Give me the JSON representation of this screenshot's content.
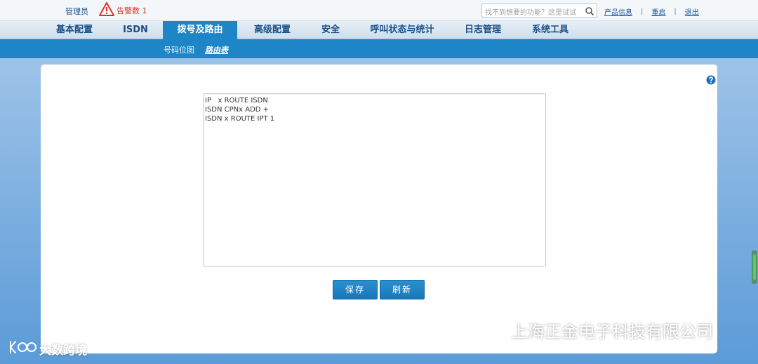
{
  "topbar": {
    "admin_label": "管理员",
    "alarm_label": "告警数 1",
    "search_placeholder": "找不到想要的功能？这里试试",
    "links": [
      "产品信息",
      "重启",
      "退出"
    ],
    "link_separator": "|"
  },
  "main_nav": {
    "tabs": [
      {
        "label": "基本配置",
        "active": false
      },
      {
        "label": "ISDN",
        "active": false
      },
      {
        "label": "拨号及路由",
        "active": true
      },
      {
        "label": "高级配置",
        "active": false
      },
      {
        "label": "安全",
        "active": false
      },
      {
        "label": "呼叫状态与统计",
        "active": false
      },
      {
        "label": "日志管理",
        "active": false
      },
      {
        "label": "系统工具",
        "active": false
      }
    ]
  },
  "sub_nav": {
    "items": [
      {
        "label": "号码位图",
        "active": false
      },
      {
        "label": "路由表",
        "active": true
      }
    ]
  },
  "routing_table": {
    "text": "IP   x ROUTE ISDN\nISDN CPNx ADD +\nISDN x ROUTE IPT 1"
  },
  "buttons": {
    "save": "保存",
    "refresh": "刷新"
  },
  "watermarks": {
    "company": "上海正金电子科技有限公司",
    "brand": "大数跨境"
  },
  "colors": {
    "accent_blue": "#1e86c6",
    "alarm_red": "#e0302a",
    "nav_text": "#1a4f86"
  },
  "icons": [
    "warning-icon",
    "search-icon",
    "help-icon",
    "wechat-icon",
    "brand-logo-icon"
  ]
}
